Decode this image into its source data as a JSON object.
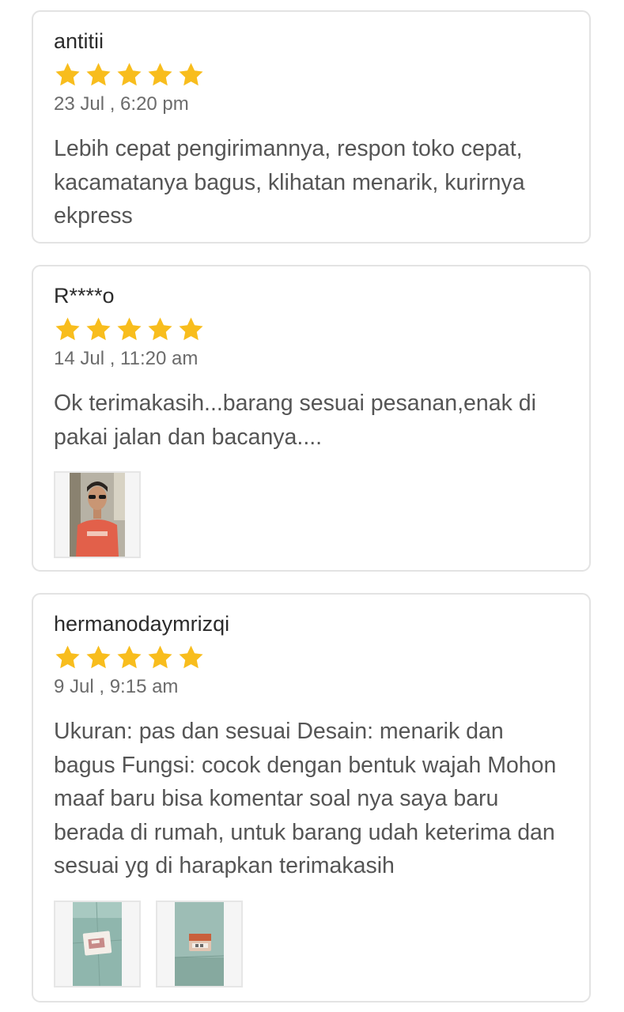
{
  "colors": {
    "star": "#f8bd1d",
    "card_border": "#e3e3e3",
    "text": "#555555"
  },
  "reviews": [
    {
      "reviewer": "antitii",
      "rating": 5,
      "date": "23 Jul , 6:20 pm",
      "text": "Lebih cepat pengirimannya, respon toko cepat, kacamatanya bagus, klihatan menarik, kurirnya ekpress",
      "photos": []
    },
    {
      "reviewer": "R****o",
      "rating": 5,
      "date": "14 Jul , 11:20 am",
      "text": "Ok terimakasih...barang sesuai pesanan,enak di pakai jalan dan bacanya....",
      "photos": [
        "photo-person-with-sunglasses"
      ]
    },
    {
      "reviewer": "hermanodaymrizqi",
      "rating": 5,
      "date": "9 Jul , 9:15 am",
      "text": "Ukuran: pas dan sesuai Desain: menarik dan bagus Fungsi: cocok dengan bentuk wajah Mohon maaf baru bisa komentar soal nya saya baru berada di rumah, untuk barang udah keterima dan sesuai yg di harapkan terimakasih",
      "photos": [
        "photo-package-box",
        "photo-package-label"
      ]
    }
  ]
}
